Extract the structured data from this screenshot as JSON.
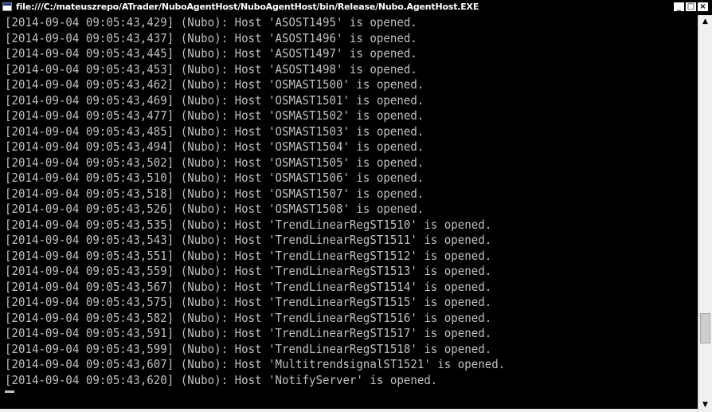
{
  "window": {
    "title": "file:///C:/mateuszrepo/ATrader/NuboAgentHost/NuboAgentHost/bin/Release/Nubo.AgentHost.EXE",
    "controls": {
      "minimize": "_",
      "maximize": "□",
      "close": "×"
    }
  },
  "console": {
    "lines": [
      "[2014-09-04 09:05:43,429] (Nubo): Host 'ASOST1495' is opened.",
      "[2014-09-04 09:05:43,437] (Nubo): Host 'ASOST1496' is opened.",
      "[2014-09-04 09:05:43,445] (Nubo): Host 'ASOST1497' is opened.",
      "[2014-09-04 09:05:43,453] (Nubo): Host 'ASOST1498' is opened.",
      "[2014-09-04 09:05:43,462] (Nubo): Host 'OSMAST1500' is opened.",
      "[2014-09-04 09:05:43,469] (Nubo): Host 'OSMAST1501' is opened.",
      "[2014-09-04 09:05:43,477] (Nubo): Host 'OSMAST1502' is opened.",
      "[2014-09-04 09:05:43,485] (Nubo): Host 'OSMAST1503' is opened.",
      "[2014-09-04 09:05:43,494] (Nubo): Host 'OSMAST1504' is opened.",
      "[2014-09-04 09:05:43,502] (Nubo): Host 'OSMAST1505' is opened.",
      "[2014-09-04 09:05:43,510] (Nubo): Host 'OSMAST1506' is opened.",
      "[2014-09-04 09:05:43,518] (Nubo): Host 'OSMAST1507' is opened.",
      "[2014-09-04 09:05:43,526] (Nubo): Host 'OSMAST1508' is opened.",
      "[2014-09-04 09:05:43,535] (Nubo): Host 'TrendLinearRegST1510' is opened.",
      "[2014-09-04 09:05:43,543] (Nubo): Host 'TrendLinearRegST1511' is opened.",
      "[2014-09-04 09:05:43,551] (Nubo): Host 'TrendLinearRegST1512' is opened.",
      "[2014-09-04 09:05:43,559] (Nubo): Host 'TrendLinearRegST1513' is opened.",
      "[2014-09-04 09:05:43,567] (Nubo): Host 'TrendLinearRegST1514' is opened.",
      "[2014-09-04 09:05:43,575] (Nubo): Host 'TrendLinearRegST1515' is opened.",
      "[2014-09-04 09:05:43,582] (Nubo): Host 'TrendLinearRegST1516' is opened.",
      "[2014-09-04 09:05:43,591] (Nubo): Host 'TrendLinearRegST1517' is opened.",
      "[2014-09-04 09:05:43,599] (Nubo): Host 'TrendLinearRegST1518' is opened.",
      "[2014-09-04 09:05:43,607] (Nubo): Host 'MultitrendsignalST1521' is opened.",
      "[2014-09-04 09:05:43,620] (Nubo): Host 'NotifyServer' is opened."
    ]
  },
  "scrollbar": {
    "up_icon": "up-arrow-icon",
    "down_icon": "down-arrow-icon"
  }
}
